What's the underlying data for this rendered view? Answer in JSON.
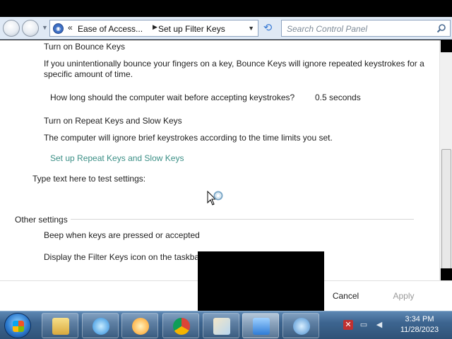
{
  "nav": {
    "breadcrumb": [
      "Ease of Access...",
      "Set up Filter Keys"
    ],
    "search_placeholder": "Search Control Panel"
  },
  "content": {
    "bounce_heading": "Turn on Bounce Keys",
    "bounce_desc_line1": "If you unintentionally bounce your fingers on a key, Bounce Keys will ignore repeated keystrokes for a",
    "bounce_desc_line2": "specific amount of time.",
    "bounce_wait_label": "How long should the computer wait before accepting keystrokes?",
    "bounce_wait_value": "0.5 seconds",
    "repeat_heading": "Turn on Repeat Keys and Slow Keys",
    "repeat_desc": "The computer will ignore brief keystrokes according to the time limits you set.",
    "repeat_link": "Set up Repeat Keys and Slow Keys",
    "test_label": "Type text here to test settings:",
    "other_heading": "Other settings",
    "beep_option": "Beep when keys are pressed or accepted",
    "icon_option": "Display the Filter Keys icon on the taskbar"
  },
  "footer": {
    "cancel": "Cancel",
    "apply": "Apply"
  },
  "taskbar": {
    "apps": [
      "file-explorer",
      "internet-explorer",
      "media-player",
      "chrome",
      "paint",
      "remote-desktop",
      "network"
    ],
    "time": "3:34 PM",
    "date": "11/28/2023"
  }
}
